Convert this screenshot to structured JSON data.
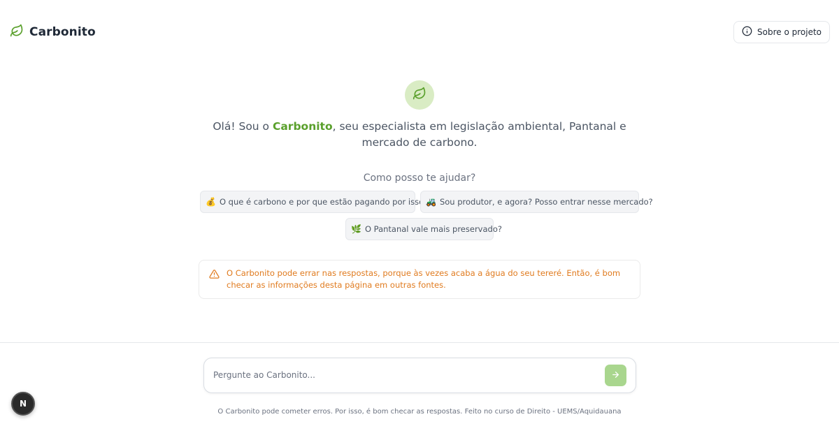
{
  "header": {
    "brand": "Carbonito",
    "brand_icon": "leaf-icon",
    "about_label": "Sobre o projeto",
    "about_icon": "info-icon"
  },
  "hero": {
    "icon": "leaf-icon",
    "intro_prefix": "Olá! Sou o ",
    "intro_highlight": "Carbonito",
    "intro_suffix": ", seu especialista em legislação ambiental, Pantanal e mercado de carbono.",
    "how_can_i_help": "Como posso te ajudar?"
  },
  "suggestions": [
    {
      "emoji": "💰",
      "label": "O que é carbono e por que estão pagando por isso?"
    },
    {
      "emoji": "🚜",
      "label": "Sou produtor, e agora? Posso entrar nesse mercado?"
    },
    {
      "emoji": "🌿",
      "label": "O Pantanal vale mais preservado?"
    }
  ],
  "warning": {
    "icon": "warning-triangle-icon",
    "text": "O Carbonito pode errar nas respostas, porque às vezes acaba a água do seu tereré. Então, é bom checar as informações desta página em outras fontes."
  },
  "composer": {
    "placeholder": "Pergunte ao Carbonito...",
    "value": "",
    "send_icon": "arrow-right-icon"
  },
  "footer": {
    "text": "O Carbonito pode cometer erros. Por isso, é bom checar as respostas. Feito no curso de Direito - UEMS/Aquidauana"
  },
  "dev_badge": {
    "label": "N"
  },
  "colors": {
    "accent": "#5aa02c",
    "accent_soft": "#d9ecc4",
    "send_button": "#a9d68e",
    "warning": "#e07b1f"
  }
}
